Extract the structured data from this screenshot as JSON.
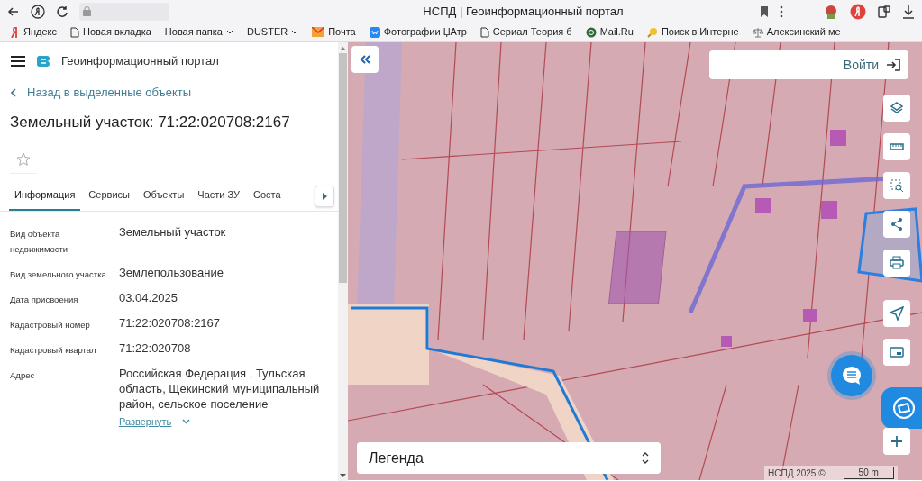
{
  "browser": {
    "title": "НСПД | Геоинформационный портал",
    "bookmarks": [
      {
        "label": "Яндекс",
        "kind": "yandex"
      },
      {
        "label": "Новая вкладка",
        "kind": "page"
      },
      {
        "label": "Новая папка",
        "kind": "folder"
      },
      {
        "label": "DUSTER",
        "kind": "folder"
      },
      {
        "label": "Почта",
        "kind": "mail"
      },
      {
        "label": "Фотографии ЏАтр",
        "kind": "vk"
      },
      {
        "label": "Сериал Теория б",
        "kind": "page"
      },
      {
        "label": "Mail.Ru",
        "kind": "mailru"
      },
      {
        "label": "Поиск в Интерне",
        "kind": "search"
      },
      {
        "label": "Алексинский ме",
        "kind": "scales"
      }
    ]
  },
  "panel": {
    "app_title": "Геоинформационный портал",
    "back_link": "Назад в выделенные объекты",
    "heading": "Земельный участок: 71:22:020708:2167",
    "tabs": [
      {
        "label": "Информация",
        "selected": true
      },
      {
        "label": "Сервисы",
        "selected": false
      },
      {
        "label": "Объекты",
        "selected": false
      },
      {
        "label": "Части ЗУ",
        "selected": false
      },
      {
        "label": "Соста",
        "selected": false
      }
    ],
    "fields": [
      {
        "label": "Вид объекта недвижимости",
        "value": "Земельный участок"
      },
      {
        "label": "Вид земельного участка",
        "value": "Землепользование"
      },
      {
        "label": "Дата присвоения",
        "value": "03.04.2025"
      },
      {
        "label": "Кадастровый номер",
        "value": "71:22:020708:2167"
      },
      {
        "label": "Кадастровый квартал",
        "value": "71:22:020708"
      },
      {
        "label": "Адрес",
        "value": "Российская Федерация , Тульская область, Щекинский муниципальный район, сельское поселение"
      }
    ],
    "expand_link": "Развернуть"
  },
  "map": {
    "login_button": "Войти",
    "legend": "Легенда",
    "attribution": "НСПД 2025 ©",
    "scale": "50 m"
  }
}
